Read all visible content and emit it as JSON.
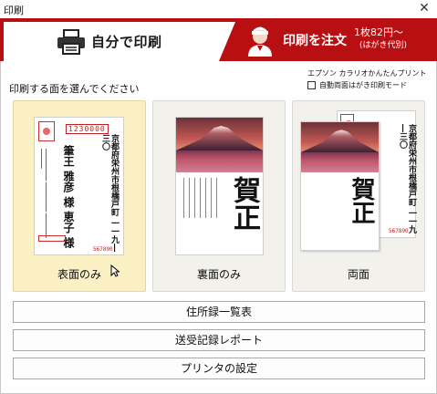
{
  "window": {
    "title": "印刷",
    "close_glyph": "✕"
  },
  "tabs": {
    "self": {
      "label": "自分で印刷",
      "icon": "printer-icon"
    },
    "order": {
      "label": "印刷を注文",
      "price": "1枚82円〜",
      "price_note": "(はがき代別)",
      "icon": "staff-person-icon"
    }
  },
  "instruction": "印刷する面を選んでください",
  "epson": {
    "label": "エプソン カラリオかんたんプリント",
    "duplex_label": "自動両面はがき印刷モード",
    "duplex_checked": false
  },
  "cards": [
    {
      "label": "表面のみ",
      "selected": true
    },
    {
      "label": "裏面のみ",
      "selected": false
    },
    {
      "label": "両面",
      "selected": false
    }
  ],
  "preview": {
    "zip": "1230000",
    "recipient_address": "京都府栄州市根橋戸町 一一九―三〇",
    "recipient_names": "筆王 雅彦 様 恵子 様",
    "sender_zip": "567890",
    "greeting": "賀正"
  },
  "buttons": {
    "address_list": "住所録一覧表",
    "send_receive_report": "送受記録レポート",
    "printer_settings": "プリンタの設定"
  },
  "colors": {
    "tab_bar": "#b80f12",
    "selected_card": "#fbf0c4"
  }
}
